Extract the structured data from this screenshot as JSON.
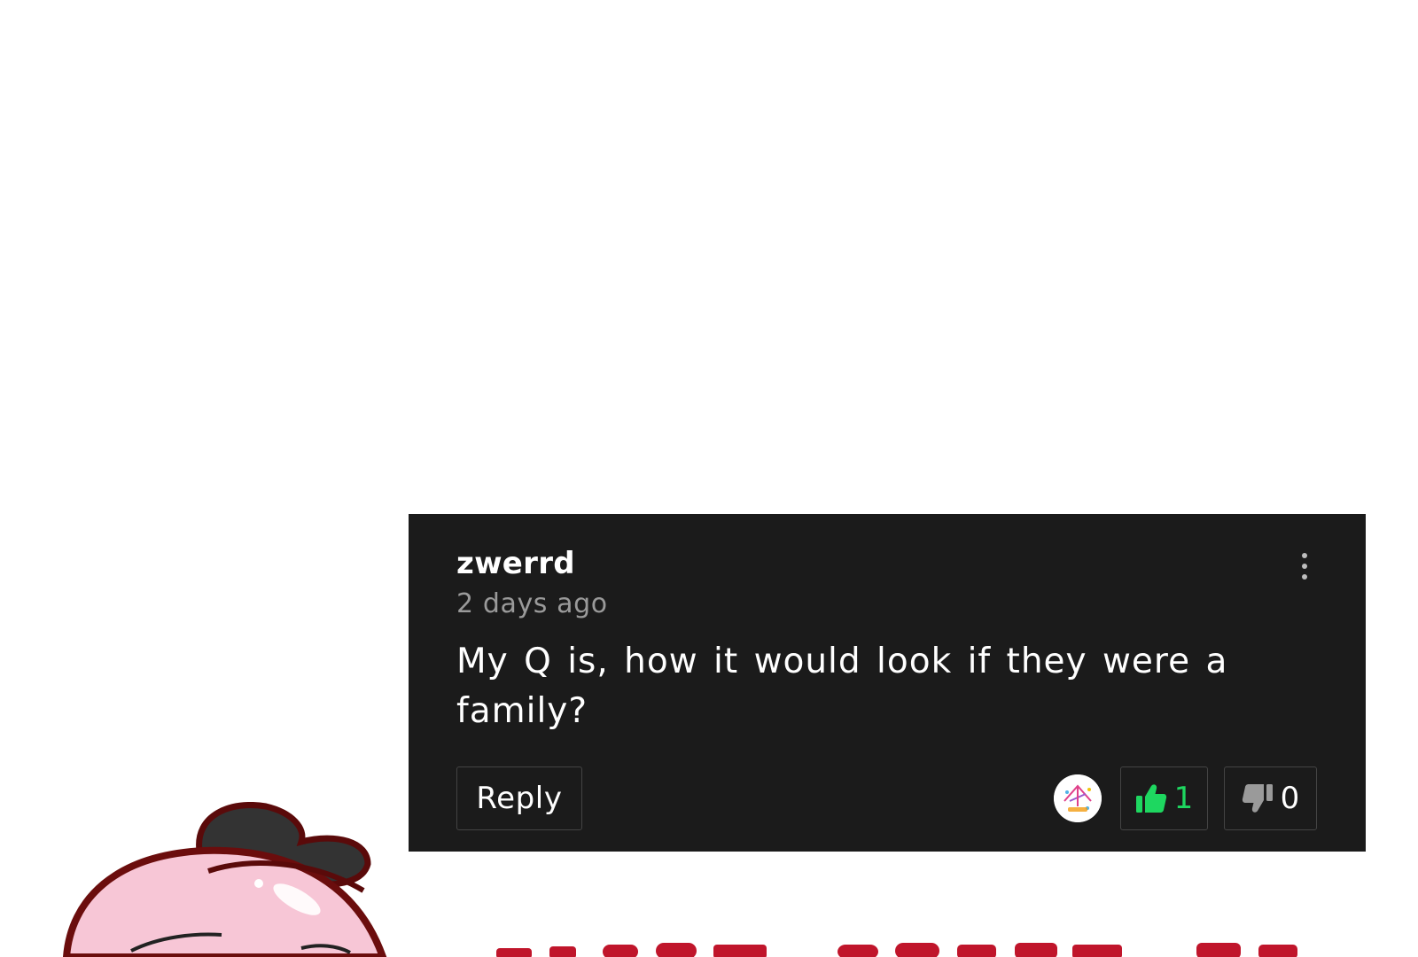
{
  "comment": {
    "author": "zwerrd",
    "posted": "2 days ago",
    "body": "My Q is, how it would look if they were a family?",
    "reply_label": "Reply",
    "upvotes": "1",
    "downvotes": "0"
  },
  "colors": {
    "card_background": "#1b1b1b",
    "upvote_accent": "#1ed760",
    "timestamp": "#9a9a9a",
    "banner_red": "#c0152b",
    "mascot_pink": "#f7c6d6"
  },
  "icons": {
    "more": "more-vertical-icon",
    "upvote": "thumbs-up-icon",
    "downvote": "thumbs-down-icon"
  }
}
